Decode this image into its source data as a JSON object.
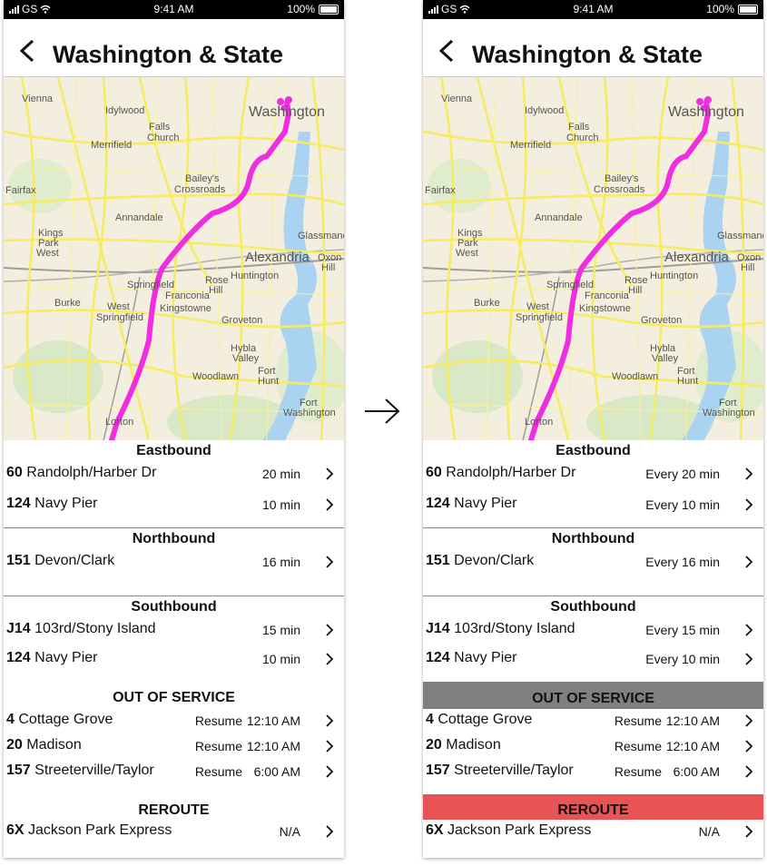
{
  "status": {
    "carrier": "GS",
    "time": "9:41 AM",
    "battery": "100%"
  },
  "page_title": "Washington & State",
  "map_labels": [
    "Vienna",
    "Idylwood",
    "Falls Church",
    "Merrifield",
    "Washington",
    "Fairfax",
    "Bailey's Crossroads",
    "Annandale",
    "Glassmanor",
    "Kings Park West",
    "Alexandria",
    "Oxon Hill",
    "Springfield",
    "Rose Hill",
    "Huntington",
    "Burke",
    "West Springfield",
    "Franconia",
    "Kingstowne",
    "Groveton",
    "Hybla Valley",
    "Fort Hunt",
    "Woodlawn",
    "Fort Washington",
    "Lorton"
  ],
  "sections": {
    "eastbound": "Eastbound",
    "northbound": "Northbound",
    "southbound": "Southbound",
    "out_of_service": "OUT OF SERVICE",
    "reroute": "REROUTE"
  },
  "resume_label": "Resume",
  "before": {
    "eastbound": [
      {
        "num": "60",
        "name": "Randolph/Harber Dr",
        "time": "20 min"
      },
      {
        "num": "124",
        "name": "Navy Pier",
        "time": "10 min"
      }
    ],
    "northbound": [
      {
        "num": "151",
        "name": "Devon/Clark",
        "time": "16 min"
      }
    ],
    "southbound": [
      {
        "num": "J14",
        "name": "103rd/Stony Island",
        "time": "15 min"
      },
      {
        "num": "124",
        "name": "Navy Pier",
        "time": "10 min"
      }
    ],
    "out_of_service": [
      {
        "num": "4",
        "name": "Cottage Grove",
        "time": "12:10 AM"
      },
      {
        "num": "20",
        "name": "Madison",
        "time": "12:10 AM"
      },
      {
        "num": "157",
        "name": "Streeterville/Taylor",
        "time": "6:00 AM"
      }
    ],
    "reroute": [
      {
        "num": "6X",
        "name": "Jackson Park Express",
        "time": "N/A"
      }
    ]
  },
  "after": {
    "eastbound": [
      {
        "num": "60",
        "name": "Randolph/Harber Dr",
        "time": "Every 20 min"
      },
      {
        "num": "124",
        "name": "Navy Pier",
        "time": "Every 10 min"
      }
    ],
    "northbound": [
      {
        "num": "151",
        "name": "Devon/Clark",
        "time": "Every 16 min"
      }
    ],
    "southbound": [
      {
        "num": "J14",
        "name": "103rd/Stony Island",
        "time": "Every 15 min"
      },
      {
        "num": "124",
        "name": "Navy Pier",
        "time": "Every 10 min"
      }
    ],
    "out_of_service": [
      {
        "num": "4",
        "name": "Cottage Grove",
        "time": "12:10 AM"
      },
      {
        "num": "20",
        "name": "Madison",
        "time": "12:10 AM"
      },
      {
        "num": "157",
        "name": "Streeterville/Taylor",
        "time": "6:00 AM"
      }
    ],
    "reroute": [
      {
        "num": "6X",
        "name": "Jackson Park Express",
        "time": "N/A"
      }
    ]
  },
  "colors": {
    "route": "#ee2ee0",
    "oos_highlight": "#808080",
    "reroute_highlight": "#e85456",
    "water": "#a9d3f0",
    "road": "#f7ec5f"
  },
  "icons": {
    "back": "chevron-left-icon",
    "chevron": "chevron-right-icon",
    "transition": "arrow-right-icon"
  }
}
